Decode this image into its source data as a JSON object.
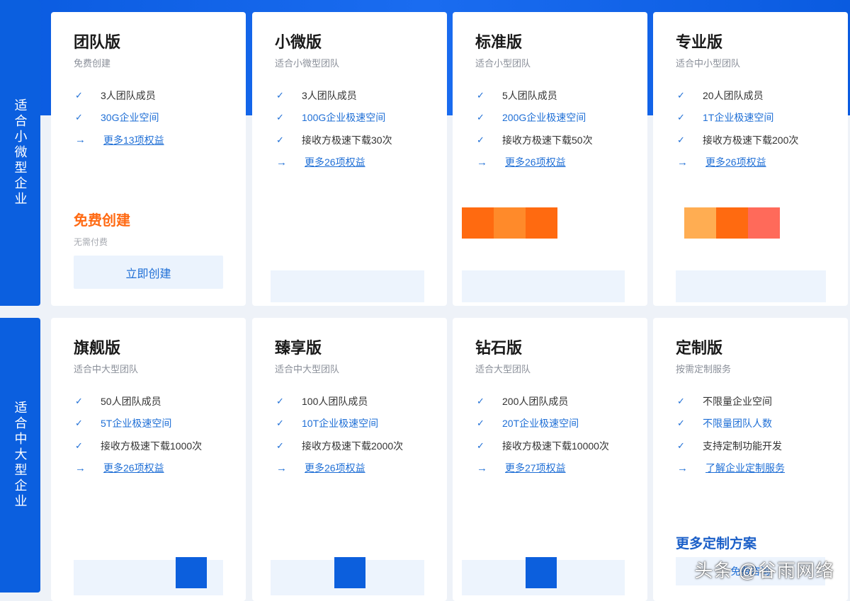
{
  "categories": {
    "small": "适合小微型企业",
    "large": "适合中大型企业"
  },
  "plans": [
    {
      "name": "团队版",
      "subtitle": "免费创建",
      "features": [
        "3人团队成员",
        "30G企业空间"
      ],
      "more": "更多13项权益",
      "price_label": "免费创建",
      "price_note": "无需付费",
      "button": "立即创建"
    },
    {
      "name": "小微版",
      "subtitle": "适合小微型团队",
      "features": [
        "3人团队成员",
        "100G企业极速空间",
        "接收方极速下载30次"
      ],
      "more": "更多26项权益"
    },
    {
      "name": "标准版",
      "subtitle": "适合小型团队",
      "features": [
        "5人团队成员",
        "200G企业极速空间",
        "接收方极速下载50次"
      ],
      "more": "更多26项权益"
    },
    {
      "name": "专业版",
      "subtitle": "适合中小型团队",
      "features": [
        "20人团队成员",
        "1T企业极速空间",
        "接收方极速下载200次"
      ],
      "more": "更多26项权益"
    },
    {
      "name": "旗舰版",
      "subtitle": "适合中大型团队",
      "features": [
        "50人团队成员",
        "5T企业极速空间",
        "接收方极速下载1000次"
      ],
      "more": "更多26项权益"
    },
    {
      "name": "臻享版",
      "subtitle": "适合中大型团队",
      "features": [
        "100人团队成员",
        "10T企业极速空间",
        "接收方极速下载2000次"
      ],
      "more": "更多26项权益"
    },
    {
      "name": "钻石版",
      "subtitle": "适合大型团队",
      "features": [
        "200人团队成员",
        "20T企业极速空间",
        "接收方极速下载10000次"
      ],
      "more": "更多27项权益"
    },
    {
      "name": "定制版",
      "subtitle": "按需定制服务",
      "features": [
        "不限量企业空间",
        "不限量团队人数",
        "支持定制功能开发"
      ],
      "more": "了解企业定制服务",
      "extra_title": "更多定制方案",
      "extra_button": "免费咨询"
    }
  ],
  "watermark": "头条 @谷雨网络",
  "colors": {
    "brand_blue": "#0b5fdf",
    "link_blue": "#1f6fd6",
    "price_orange": "#ff6a13"
  },
  "icons": {
    "feature": "check-icon",
    "more": "arrow-right-icon"
  }
}
